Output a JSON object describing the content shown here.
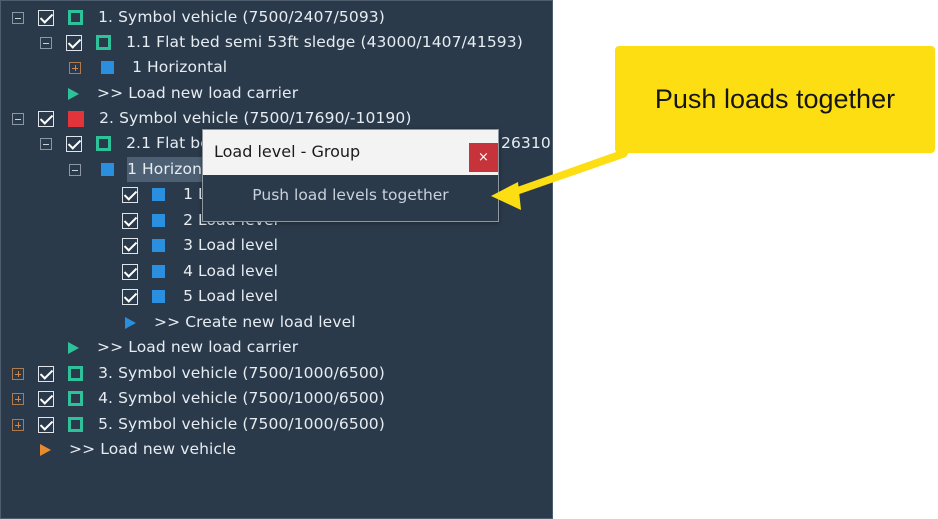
{
  "tree": {
    "vehicle1": "1. Symbol vehicle (7500/2407/5093)",
    "carrier11": "1.1 Flat bed semi 53ft sledge (43000/1407/41593)",
    "level_h1": "1 Horizontal",
    "load_carrier_1": ">> Load new load carrier",
    "vehicle2": "2. Symbol vehicle (7500/17690/-10190)",
    "carrier21": "2.1 Flat bed semi 53ft sledge (43000/16690/26310",
    "carrier21_partial_left": "2.1 Flat be",
    "carrier21_partial_right": "26310",
    "level_h2": "1 Horizontal",
    "level_h2_partial": "1 Horizont",
    "levels": [
      "1 Load level",
      "2 Load level",
      "3 Load level",
      "4 Load level",
      "5 Load level"
    ],
    "level1_partial": "1 L",
    "create_level": ">> Create new load level",
    "load_carrier_2": ">> Load new load carrier",
    "vehicle3": "3. Symbol vehicle (7500/1000/6500)",
    "vehicle4": "4. Symbol vehicle (7500/1000/6500)",
    "vehicle5": "5. Symbol vehicle (7500/1000/6500)",
    "load_vehicle": ">> Load new vehicle"
  },
  "dialog": {
    "title": "Load level - Group",
    "close": "×",
    "item": "Push load levels together"
  },
  "callout": {
    "text": "Push loads together",
    "color": "#fdde12"
  },
  "colors": {
    "panel_bg": "#2b3a4a",
    "green": "#2ec29a",
    "red": "#e2343a",
    "blue": "#2b8fe0",
    "orange": "#e88b2e"
  }
}
